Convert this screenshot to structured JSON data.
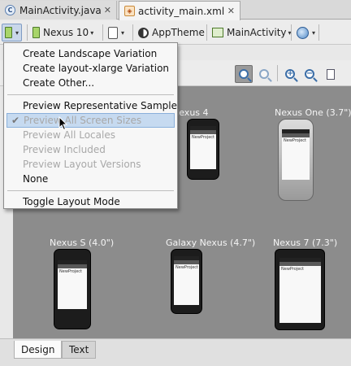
{
  "tabs": [
    {
      "label": "MainActivity.java",
      "icon": "java-class-icon"
    },
    {
      "label": "activity_main.xml",
      "icon": "xml-layout-icon"
    }
  ],
  "toolbar": {
    "device": "Nexus 10",
    "theme": "AppTheme",
    "activity": "MainActivity"
  },
  "menu": {
    "group1": [
      "Create Landscape Variation",
      "Create layout-xlarge Variation",
      "Create Other..."
    ],
    "group2": [
      {
        "label": "Preview Representative Sample",
        "enabled": true,
        "checked": false
      },
      {
        "label": "Preview All Screen Sizes",
        "enabled": false,
        "checked": true
      },
      {
        "label": "Preview All Locales",
        "enabled": false,
        "checked": false
      },
      {
        "label": "Preview Included",
        "enabled": false,
        "checked": false
      },
      {
        "label": "Preview Layout Versions",
        "enabled": false,
        "checked": false
      },
      {
        "label": "None",
        "enabled": true,
        "checked": false
      }
    ],
    "group3": [
      "Toggle Layout Mode"
    ]
  },
  "devices": [
    {
      "label": "Nexus 4"
    },
    {
      "label": "Nexus One (3.7\")"
    },
    {
      "label": "Nexus S (4.0\")"
    },
    {
      "label": "Galaxy Nexus (4.7\")"
    },
    {
      "label": "Nexus 7 (7.3\")"
    }
  ],
  "screen_text": "NewProject",
  "bottom_tabs": [
    "Design",
    "Text"
  ],
  "colors": {
    "accent": "#c6daf0",
    "canvas": "#8c8c8c"
  }
}
